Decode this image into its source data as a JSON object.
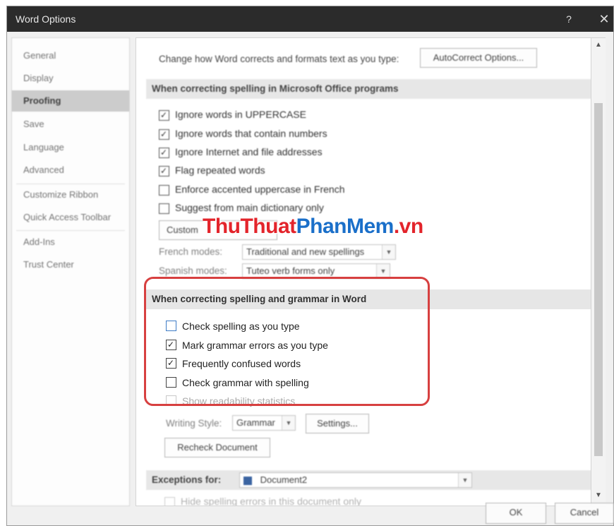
{
  "window": {
    "title": "Word Options",
    "help_glyph": "?",
    "close_glyph": "✕"
  },
  "sidebar": {
    "items": [
      {
        "label": "General"
      },
      {
        "label": "Display"
      },
      {
        "label": "Proofing",
        "selected": true
      },
      {
        "label": "Save"
      },
      {
        "label": "Language"
      },
      {
        "label": "Advanced"
      },
      {
        "label": "Customize Ribbon"
      },
      {
        "label": "Quick Access Toolbar"
      },
      {
        "label": "Add-Ins"
      },
      {
        "label": "Trust Center"
      }
    ]
  },
  "autocorrect": {
    "description": "Change how Word corrects and formats text as you type:",
    "button_label": "AutoCorrect Options..."
  },
  "office_section": {
    "header": "When correcting spelling in Microsoft Office programs",
    "options": [
      {
        "label": "Ignore words in UPPERCASE",
        "checked": true
      },
      {
        "label": "Ignore words that contain numbers",
        "checked": true
      },
      {
        "label": "Ignore Internet and file addresses",
        "checked": true
      },
      {
        "label": "Flag repeated words",
        "checked": true
      },
      {
        "label": "Enforce accented uppercase in French",
        "checked": false
      },
      {
        "label": "Suggest from main dictionary only",
        "checked": false
      }
    ],
    "custom_button_label": "Custom",
    "french_modes_label": "French modes:",
    "french_modes_value": "Traditional and new spellings",
    "spanish_modes_label": "Spanish modes:",
    "spanish_modes_value": "Tuteo verb forms only"
  },
  "word_section": {
    "header": "When correcting spelling and grammar in Word",
    "options": [
      {
        "label": "Check spelling as you type",
        "checked": false
      },
      {
        "label": "Mark grammar errors as you type",
        "checked": true
      },
      {
        "label": "Frequently confused words",
        "checked": true
      },
      {
        "label": "Check grammar with spelling",
        "checked": false
      },
      {
        "label": "Show readability statistics",
        "checked": false,
        "disabled": true
      }
    ],
    "writing_style_label": "Writing Style:",
    "writing_style_value": "Grammar",
    "settings_button_label": "Settings...",
    "recheck_button_label": "Recheck Document"
  },
  "exceptions": {
    "label": "Exceptions for:",
    "document": "Document2",
    "hidden_option": "Hide spelling errors in this document only"
  },
  "watermark": {
    "part1": "ThuThuat",
    "part2": "PhanMem",
    "part3": ".vn"
  },
  "footer": {
    "ok_label": "OK",
    "cancel_label": "Cancel"
  },
  "colors": {
    "title_bar": "#2b2b2b",
    "highlight": "#d74040",
    "checkbox_focus": "#3e7cc6"
  }
}
